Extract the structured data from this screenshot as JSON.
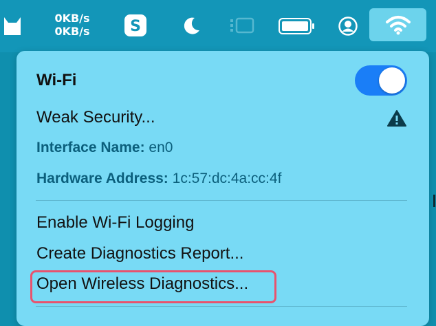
{
  "menubar": {
    "net_up": "0KB/s",
    "net_down": "0KB/s",
    "icons": [
      "cat-icon",
      "app-s-icon",
      "moon-icon",
      "stage-manager-icon",
      "battery-icon",
      "user-icon",
      "wifi-icon"
    ]
  },
  "wifi_menu": {
    "title": "Wi-Fi",
    "toggle_on": true,
    "weak_security": "Weak Security...",
    "interface_label": "Interface Name:",
    "interface_value": "en0",
    "hardware_label": "Hardware Address:",
    "hardware_value": "1c:57:dc:4a:cc:4f",
    "enable_logging": "Enable Wi-Fi Logging",
    "create_report": "Create Diagnostics Report...",
    "open_diagnostics": "Open Wireless Diagnostics..."
  },
  "colors": {
    "menubar": "#1396b8",
    "menu_bg": "#78daf5",
    "toggle": "#1a7ef7",
    "highlight": "#e8536e"
  }
}
